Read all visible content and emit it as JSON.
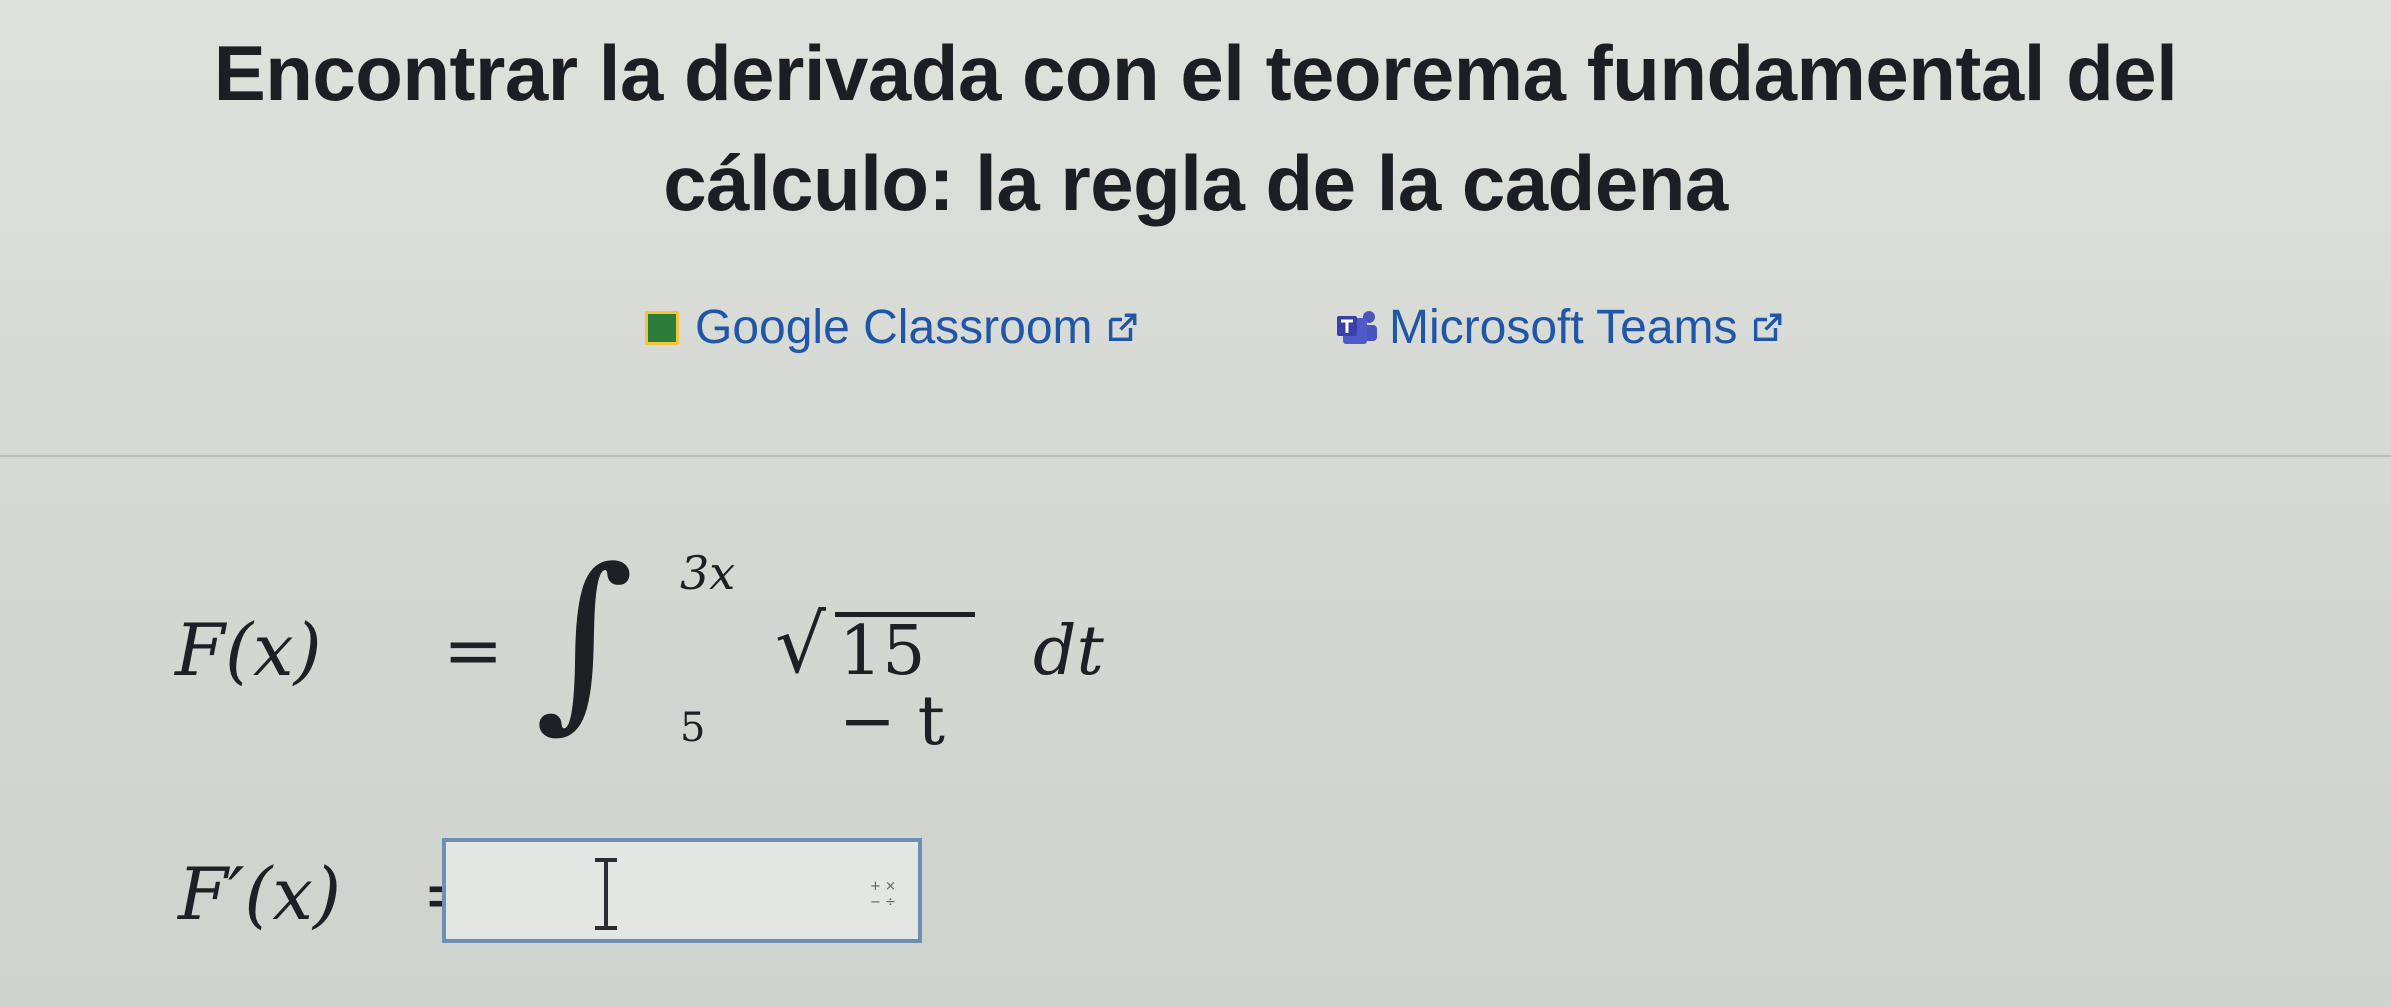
{
  "title": {
    "line1": "Encontrar la derivada con el teorema fundamental del",
    "line2": "cálculo: la regla de la cadena"
  },
  "share": {
    "google_classroom": "Google Classroom",
    "microsoft_teams": "Microsoft Teams"
  },
  "problem": {
    "function_lhs": "F(x)",
    "equals": "=",
    "integral_sign": "∫",
    "upper_limit": "3x",
    "lower_limit": "5",
    "radical_sign": "√",
    "radicand": "15 − t",
    "differential": "dt"
  },
  "answer": {
    "lhs": "F′(x)",
    "equals": "=",
    "value": ""
  },
  "colors": {
    "link": "#1f56a8",
    "input_border": "#6d8fb4"
  }
}
